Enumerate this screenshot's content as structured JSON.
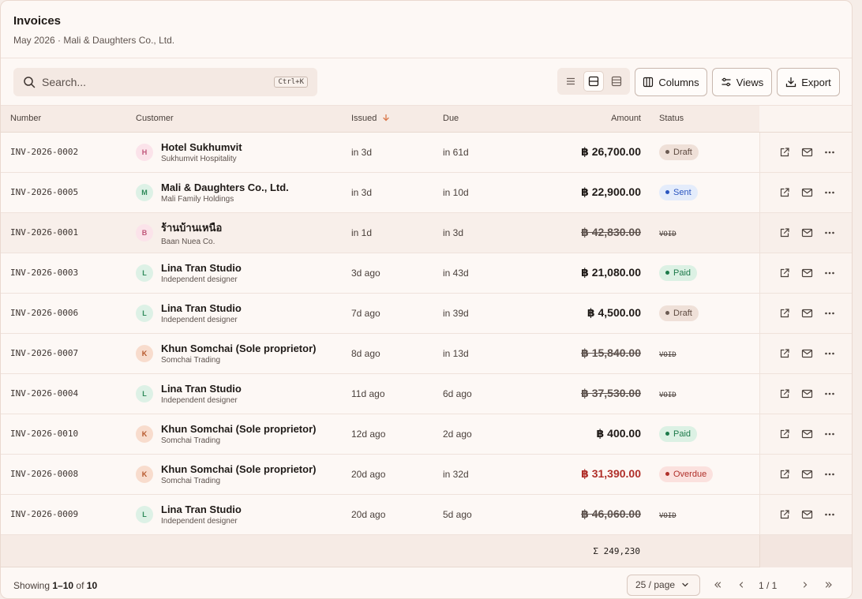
{
  "header": {
    "title": "Invoices",
    "subtitle": "May 2026 · Mali & Daughters Co., Ltd."
  },
  "toolbar": {
    "search_placeholder": "Search...",
    "search_shortcut": "Ctrl+K",
    "columns_label": "Columns",
    "views_label": "Views",
    "export_label": "Export"
  },
  "table": {
    "headers": {
      "number": "Number",
      "customer": "Customer",
      "issued": "Issued",
      "due": "Due",
      "amount": "Amount",
      "status": "Status"
    },
    "rows": [
      {
        "number": "INV-2026-0002",
        "initial": "H",
        "avatar_bg": "#fbe3ea",
        "avatar_fg": "#c0567a",
        "customer": "Hotel Sukhumvit",
        "sub": "Sukhumvit Hospitality",
        "issued": "in 3d",
        "due": "in 61d",
        "amount": "฿ 26,700.00",
        "amount_style": "normal",
        "status": "Draft",
        "status_kind": "draft"
      },
      {
        "number": "INV-2026-0005",
        "initial": "M",
        "avatar_bg": "#ddf1e6",
        "avatar_fg": "#2f8a5a",
        "customer": "Mali & Daughters Co., Ltd.",
        "sub": "Mali Family Holdings",
        "issued": "in 3d",
        "due": "in 10d",
        "amount": "฿ 22,900.00",
        "amount_style": "normal",
        "status": "Sent",
        "status_kind": "sent"
      },
      {
        "number": "INV-2026-0001",
        "initial": "B",
        "avatar_bg": "#fbe3ea",
        "avatar_fg": "#c0567a",
        "customer": "ร้านบ้านเหนือ",
        "sub": "Baan Nuea Co.",
        "issued": "in 1d",
        "due": "in 3d",
        "amount": "฿ 42,830.00",
        "amount_style": "void",
        "status": "VOID",
        "status_kind": "void"
      },
      {
        "number": "INV-2026-0003",
        "initial": "L",
        "avatar_bg": "#ddf1e6",
        "avatar_fg": "#2f8a5a",
        "customer": "Lina Tran Studio",
        "sub": "Independent designer",
        "issued": "3d ago",
        "due": "in 43d",
        "amount": "฿ 21,080.00",
        "amount_style": "normal",
        "status": "Paid",
        "status_kind": "paid"
      },
      {
        "number": "INV-2026-0006",
        "initial": "L",
        "avatar_bg": "#ddf1e6",
        "avatar_fg": "#2f8a5a",
        "customer": "Lina Tran Studio",
        "sub": "Independent designer",
        "issued": "7d ago",
        "due": "in 39d",
        "amount": "฿ 4,500.00",
        "amount_style": "normal",
        "status": "Draft",
        "status_kind": "draft"
      },
      {
        "number": "INV-2026-0007",
        "initial": "K",
        "avatar_bg": "#f8dccd",
        "avatar_fg": "#b5562a",
        "customer": "Khun Somchai (Sole proprietor)",
        "sub": "Somchai Trading",
        "issued": "8d ago",
        "due": "in 13d",
        "amount": "฿ 15,840.00",
        "amount_style": "void",
        "status": "VOID",
        "status_kind": "void"
      },
      {
        "number": "INV-2026-0004",
        "initial": "L",
        "avatar_bg": "#ddf1e6",
        "avatar_fg": "#2f8a5a",
        "customer": "Lina Tran Studio",
        "sub": "Independent designer",
        "issued": "11d ago",
        "due": "6d ago",
        "amount": "฿ 37,530.00",
        "amount_style": "void",
        "status": "VOID",
        "status_kind": "void"
      },
      {
        "number": "INV-2026-0010",
        "initial": "K",
        "avatar_bg": "#f8dccd",
        "avatar_fg": "#b5562a",
        "customer": "Khun Somchai (Sole proprietor)",
        "sub": "Somchai Trading",
        "issued": "12d ago",
        "due": "2d ago",
        "amount": "฿ 400.00",
        "amount_style": "normal",
        "status": "Paid",
        "status_kind": "paid"
      },
      {
        "number": "INV-2026-0008",
        "initial": "K",
        "avatar_bg": "#f8dccd",
        "avatar_fg": "#b5562a",
        "customer": "Khun Somchai (Sole proprietor)",
        "sub": "Somchai Trading",
        "issued": "20d ago",
        "due": "in 32d",
        "amount": "฿ 31,390.00",
        "amount_style": "overdue",
        "status": "Overdue",
        "status_kind": "overdue"
      },
      {
        "number": "INV-2026-0009",
        "initial": "L",
        "avatar_bg": "#ddf1e6",
        "avatar_fg": "#2f8a5a",
        "customer": "Lina Tran Studio",
        "sub": "Independent designer",
        "issued": "20d ago",
        "due": "5d ago",
        "amount": "฿ 46,060.00",
        "amount_style": "void",
        "status": "VOID",
        "status_kind": "void"
      }
    ],
    "total": "Σ 249,230"
  },
  "status_colors": {
    "draft": {
      "bg": "#efe0d8",
      "fg": "#5e4a40",
      "dot": "#6b5a52"
    },
    "sent": {
      "bg": "#e4ecfb",
      "fg": "#2a55c0",
      "dot": "#2a55c0"
    },
    "paid": {
      "bg": "#dcf1e4",
      "fg": "#1d7a4a",
      "dot": "#1d7a4a"
    },
    "overdue": {
      "bg": "#fbe1de",
      "fg": "#b0302a",
      "dot": "#b0302a"
    }
  },
  "footer": {
    "showing_prefix": "Showing ",
    "showing_range": "1–10",
    "showing_of": " of ",
    "showing_total": "10",
    "per_page": "25 / page",
    "page_info": "1 / 1"
  },
  "icons": {
    "search": "search-icon",
    "density_list": "list-density-icon",
    "density_comfortable": "comfortable-density-icon",
    "density_compact": "compact-density-icon",
    "columns": "columns-icon",
    "views": "views-icon",
    "export": "download-icon",
    "open": "external-link-icon",
    "email": "mail-icon",
    "more": "more-icon"
  }
}
